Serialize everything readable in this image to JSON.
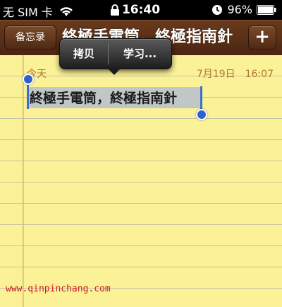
{
  "status_bar": {
    "carrier": "无 SIM 卡",
    "time": "16:40",
    "battery": "96%",
    "icons": [
      "wifi-icon",
      "lock-icon",
      "alarm-icon",
      "battery-icon"
    ]
  },
  "nav": {
    "back_label": "备忘录",
    "title": "終極手電筒，終極指南針",
    "add_label": "+"
  },
  "note": {
    "date_label": "今天",
    "date": "7月19日",
    "time": "16:07",
    "body": "終極手電筒，終極指南針"
  },
  "edit_menu": {
    "copy_label": "拷贝",
    "learn_label": "学习..."
  },
  "watermark": "www.qinpinchang.com",
  "colors": {
    "paper": "#fbf196",
    "leather": "#5a2f16",
    "date_text": "#b07a33",
    "selection": "#c1c7c4",
    "handle": "#2f62c9",
    "watermark": "#d21a1a"
  }
}
